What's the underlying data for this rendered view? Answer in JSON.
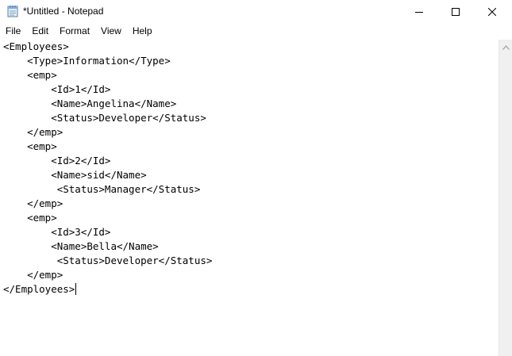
{
  "window": {
    "title": "*Untitled - Notepad",
    "app_icon": "notepad-icon",
    "controls": {
      "minimize_icon": "minimize-icon",
      "maximize_icon": "maximize-icon",
      "close_icon": "close-icon"
    }
  },
  "menu": {
    "items": [
      {
        "label": "File"
      },
      {
        "label": "Edit"
      },
      {
        "label": "Format"
      },
      {
        "label": "View"
      },
      {
        "label": "Help"
      }
    ]
  },
  "editor": {
    "lines": [
      "<Employees>",
      "    <Type>Information</Type>",
      "    <emp>",
      "        <Id>1</Id>",
      "        <Name>Angelina</Name>",
      "        <Status>Developer</Status>",
      "    </emp>",
      "    <emp>",
      "        <Id>2</Id>",
      "        <Name>sid</Name>",
      "         <Status>Manager</Status>",
      "    </emp>",
      "    <emp>",
      "        <Id>3</Id>",
      "        <Name>Bella</Name>",
      "         <Status>Developer</Status>",
      "    </emp>",
      "</Employees>"
    ]
  },
  "scrollbar": {
    "up_icon": "chevron-up-icon"
  }
}
